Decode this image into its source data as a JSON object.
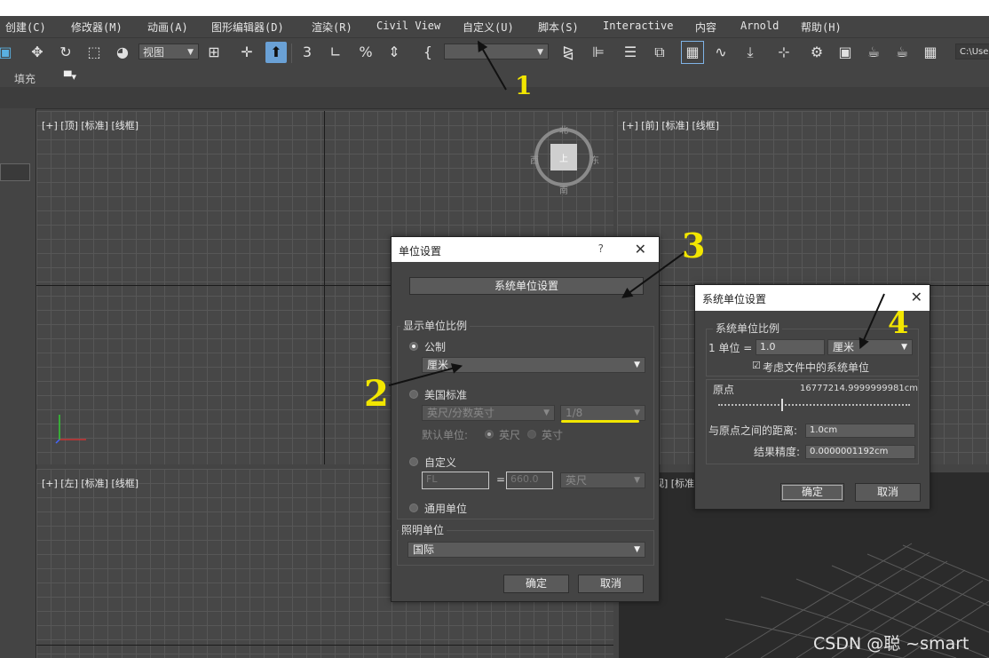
{
  "menubar": {
    "items": [
      "创建(C)",
      "修改器(M)",
      "动画(A)",
      "图形编辑器(D)",
      "渲染(R)",
      "Civil View",
      "自定义(U)",
      "脚本(S)",
      "Interactive",
      "内容",
      "Arnold",
      "帮助(H)"
    ]
  },
  "toolbar": {
    "view_dropdown": "视图",
    "path_field": "C:\\Use"
  },
  "ribbon": {
    "label": "填充",
    "icon": "▾"
  },
  "viewports": {
    "top_label": "[+] [顶] [标准] [线框]",
    "front_label": "[+] [前] [标准] [线框]",
    "left_label": "[+] [左] [标准] [线框]",
    "persp_label": "视] [标准"
  },
  "viewcube": {
    "north": "北",
    "south": "南",
    "east": "东",
    "west": "西",
    "face": "上"
  },
  "units_dialog": {
    "title": "单位设置",
    "help": "?",
    "system_button": "系统单位设置",
    "display_scale": "显示单位比例",
    "metric": "公制",
    "metric_value": "厘米",
    "us_standard": "美国标准",
    "us_value": "英尺/分数英寸",
    "fraction_value": "1/8",
    "default_unit": "默认单位:",
    "feet": "英尺",
    "inches": "英寸",
    "custom": "自定义",
    "custom_name": "FL",
    "equals": "=",
    "custom_value": "660.0",
    "custom_unit": "英尺",
    "generic": "通用单位",
    "lighting": "照明单位",
    "lighting_value": "国际",
    "ok": "确定",
    "cancel": "取消"
  },
  "system_dialog": {
    "title": "系统单位设置",
    "scale_group": "系统单位比例",
    "one_unit": "1 单位 =",
    "unit_value": "1.0",
    "unit_type": "厘米",
    "respect_files": "考虑文件中的系统单位",
    "origin": "原点",
    "origin_value": "16777214.9999999981cm",
    "distance_label": "与原点之间的距离:",
    "distance_value": "1.0cm",
    "precision_label": "结果精度:",
    "precision_value": "0.0000001192cm",
    "ok": "确定",
    "cancel": "取消"
  },
  "annotations": [
    "1",
    "2",
    "3",
    "4"
  ],
  "watermark": "CSDN @聪      ~smart"
}
